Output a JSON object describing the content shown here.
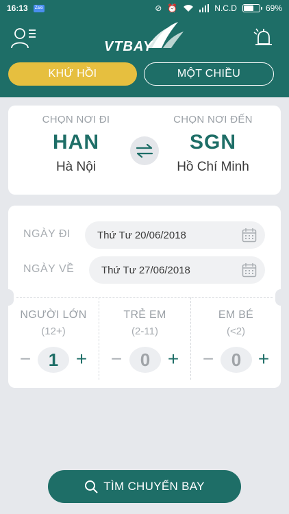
{
  "status_bar": {
    "time": "16:13",
    "app_badge": "Zalo",
    "carrier": "N.C.D",
    "battery_percent": "69%",
    "battery_level": 0.69
  },
  "header": {
    "logo_text": "VTBAY",
    "tabs": [
      {
        "label": "KHỨ HỒI",
        "active": true
      },
      {
        "label": "MỘT CHIỀU",
        "active": false
      }
    ]
  },
  "route": {
    "from": {
      "label": "CHỌN NƠI ĐI",
      "code": "HAN",
      "city": "Hà Nội"
    },
    "to": {
      "label": "CHỌN NƠI ĐẾN",
      "code": "SGN",
      "city": "Hồ Chí Minh"
    }
  },
  "dates": {
    "depart": {
      "label": "NGÀY ĐI",
      "value": "Thứ Tư 20/06/2018"
    },
    "return": {
      "label": "NGÀY VỀ",
      "value": "Thứ Tư 27/06/2018"
    }
  },
  "passengers": [
    {
      "label": "NGƯỜI LỚN",
      "range": "(12+)",
      "count": "1"
    },
    {
      "label": "TRẺ EM",
      "range": "(2-11)",
      "count": "0"
    },
    {
      "label": "EM BÉ",
      "range": "(<2)",
      "count": "0"
    }
  ],
  "search_button": {
    "label": "TÌM CHUYẾN BAY"
  },
  "colors": {
    "primary": "#1e6e67",
    "accent": "#e6bf3f",
    "background": "#e6e8ec"
  },
  "icons": [
    "user-menu-icon",
    "bell-icon",
    "swap-icon",
    "calendar-icon",
    "search-icon"
  ]
}
